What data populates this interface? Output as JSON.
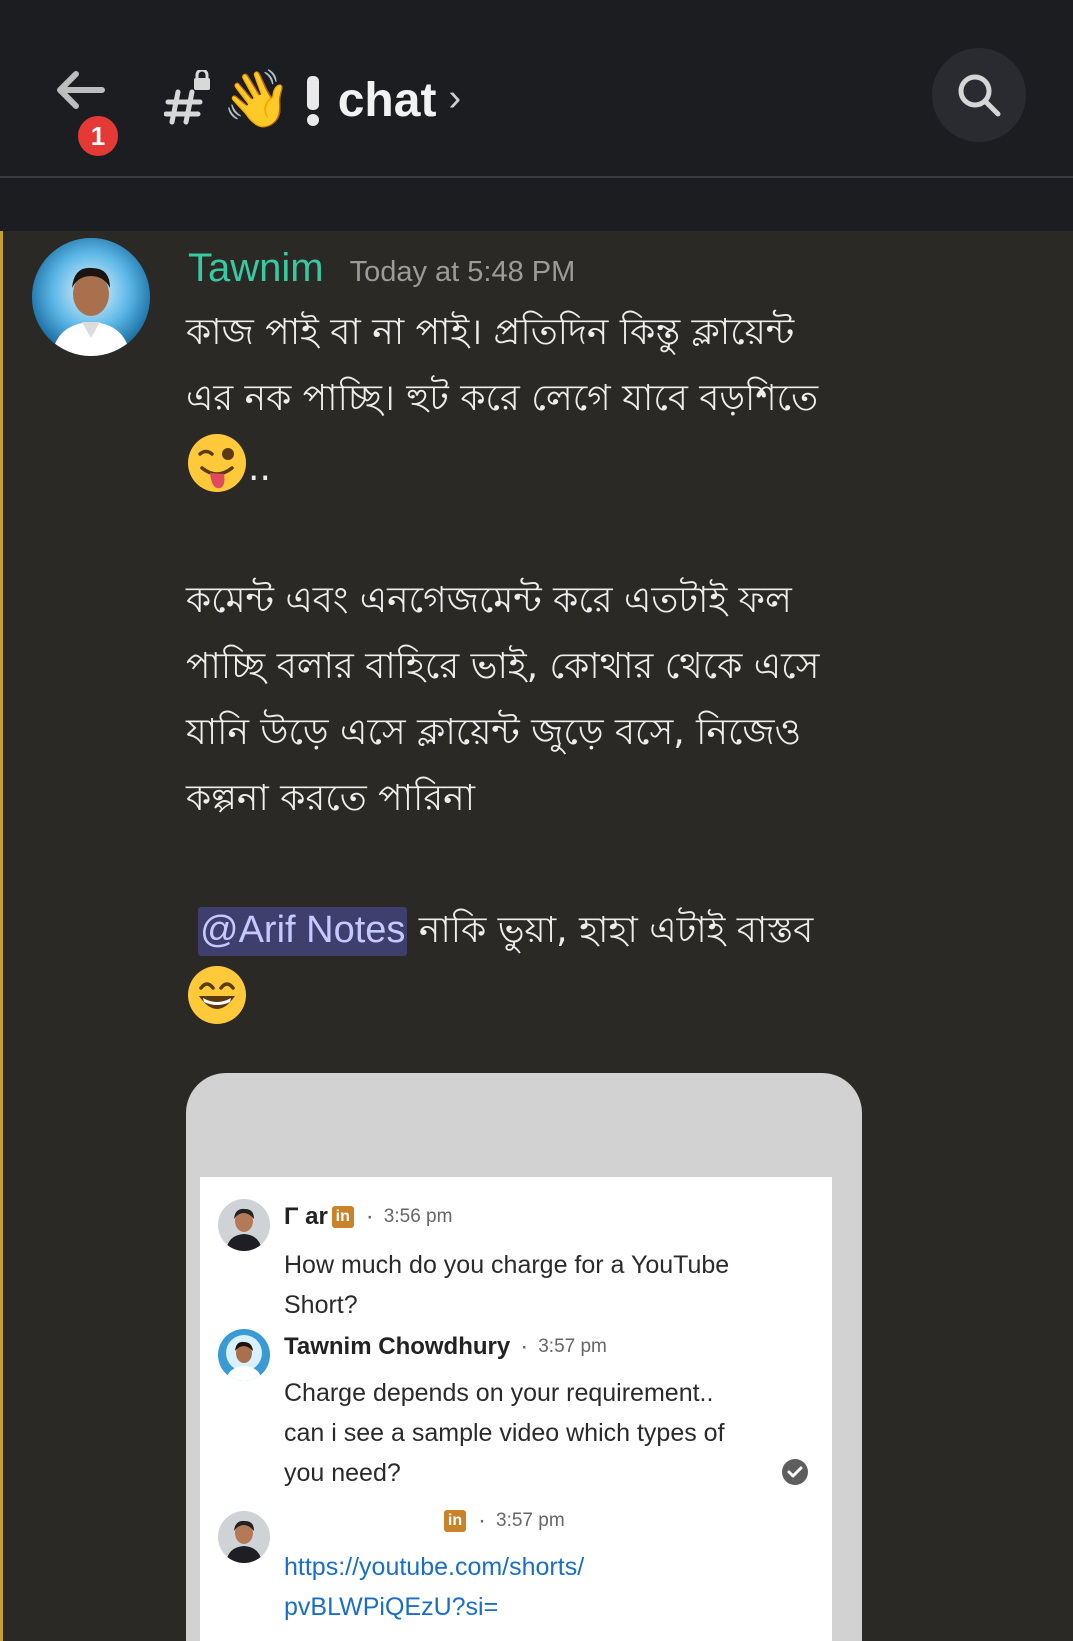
{
  "header": {
    "unread_count": "1",
    "channel_name": "chat",
    "chevron": "›",
    "icons": [
      "back-arrow-icon",
      "hash-lock-icon",
      "waving-hand-icon",
      "exclamation-icon",
      "search-icon"
    ],
    "colors": {
      "background": "#1c1d21",
      "badge": "#e53935"
    }
  },
  "message": {
    "author": "Tawnim",
    "timestamp": "Today at 5:48 PM",
    "author_color": "#38c9a3",
    "lines": [
      "কাজ পাই বা না পাই। প্রতিদিন কিন্তু ক্লায়েন্ট",
      "এর নক পাচ্ছি।  হুট করে লেগে যাবে বড়শিতে",
      "..",
      "কমেন্ট এবং এনগেজমেন্ট করে এতটাই ফল",
      "পাচ্ছি বলার বাহিরে ভাই, কোথার থেকে এসে",
      "যানি উড়ে এসে ক্লায়েন্ট জুড়ে বসে, নিজেও",
      "কল্পনা করতে পারিনা",
      "নাকি ভুয়া, হাহা এটাই বাস্তব"
    ],
    "mention": "@Arif Notes",
    "emojis": [
      "winking-tongue-emoji",
      "grinning-emoji"
    ]
  },
  "attachment": {
    "messages": [
      {
        "sender": "Γ                ar",
        "time": "3:56 pm",
        "text": "How much do you charge for a YouTube Short?",
        "linkedin_badge": "in"
      },
      {
        "sender": "Tawnim Chowdhury",
        "time": "3:57 pm",
        "text": "Charge depends on your requirement.. can i see a sample video which types of you need?"
      },
      {
        "sender": "",
        "time": "3:57 pm",
        "text_line1": "https://youtube.com/shorts/",
        "text_line2": "pvBLWPiQEzU?si=",
        "linkedin_badge": "in"
      }
    ],
    "icons": [
      "linkedin-icon",
      "read-check-icon"
    ]
  }
}
